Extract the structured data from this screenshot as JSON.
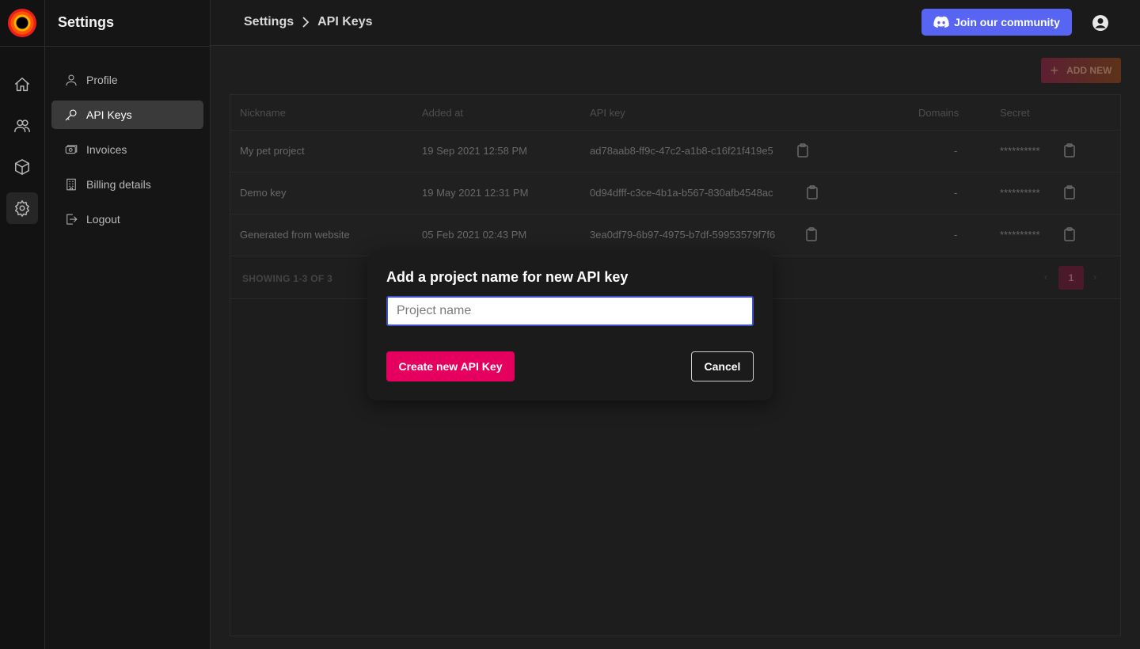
{
  "sidebar": {
    "title": "Settings",
    "items": [
      {
        "label": "Profile",
        "icon": "user-icon"
      },
      {
        "label": "API Keys",
        "icon": "key-icon",
        "active": true
      },
      {
        "label": "Invoices",
        "icon": "invoice-icon"
      },
      {
        "label": "Billing details",
        "icon": "building-icon"
      },
      {
        "label": "Logout",
        "icon": "logout-icon"
      }
    ]
  },
  "rail": {
    "icons": [
      "home-icon",
      "users-icon",
      "cube-icon",
      "gear-icon"
    ],
    "active": "gear-icon"
  },
  "header": {
    "breadcrumb": [
      "Settings",
      "API Keys"
    ],
    "discord_button": "Join our community"
  },
  "toolbar": {
    "add_new_label": "ADD NEW"
  },
  "table": {
    "columns": [
      "Nickname",
      "Added at",
      "API key",
      "Domains",
      "Secret"
    ],
    "rows": [
      {
        "nickname": "My pet project",
        "added_at": "19 Sep 2021 12:58 PM",
        "api_key": "ad78aab8-ff9c-47c2-a1b8-c16f21f419e5",
        "domains": "-",
        "secret": "**********"
      },
      {
        "nickname": "Demo key",
        "added_at": "19 May 2021 12:31 PM",
        "api_key": "0d94dfff-c3ce-4b1a-b567-830afb4548ac",
        "domains": "-",
        "secret": "**********"
      },
      {
        "nickname": "Generated from website",
        "added_at": "05 Feb 2021 02:43 PM",
        "api_key": "3ea0df79-6b97-4975-b7df-59953579f7f6",
        "domains": "-",
        "secret": "**********"
      }
    ],
    "showing": "SHOWING 1-3 OF 3",
    "current_page": "1",
    "prev": "‹",
    "next": "›"
  },
  "modal": {
    "title": "Add a project name for new API key",
    "input_placeholder": "Project name",
    "input_value": "",
    "create_label": "Create new API Key",
    "cancel_label": "Cancel"
  },
  "colors": {
    "accent": "#e5005f",
    "discord": "#5865f2",
    "input_focus": "#3f52c8"
  }
}
